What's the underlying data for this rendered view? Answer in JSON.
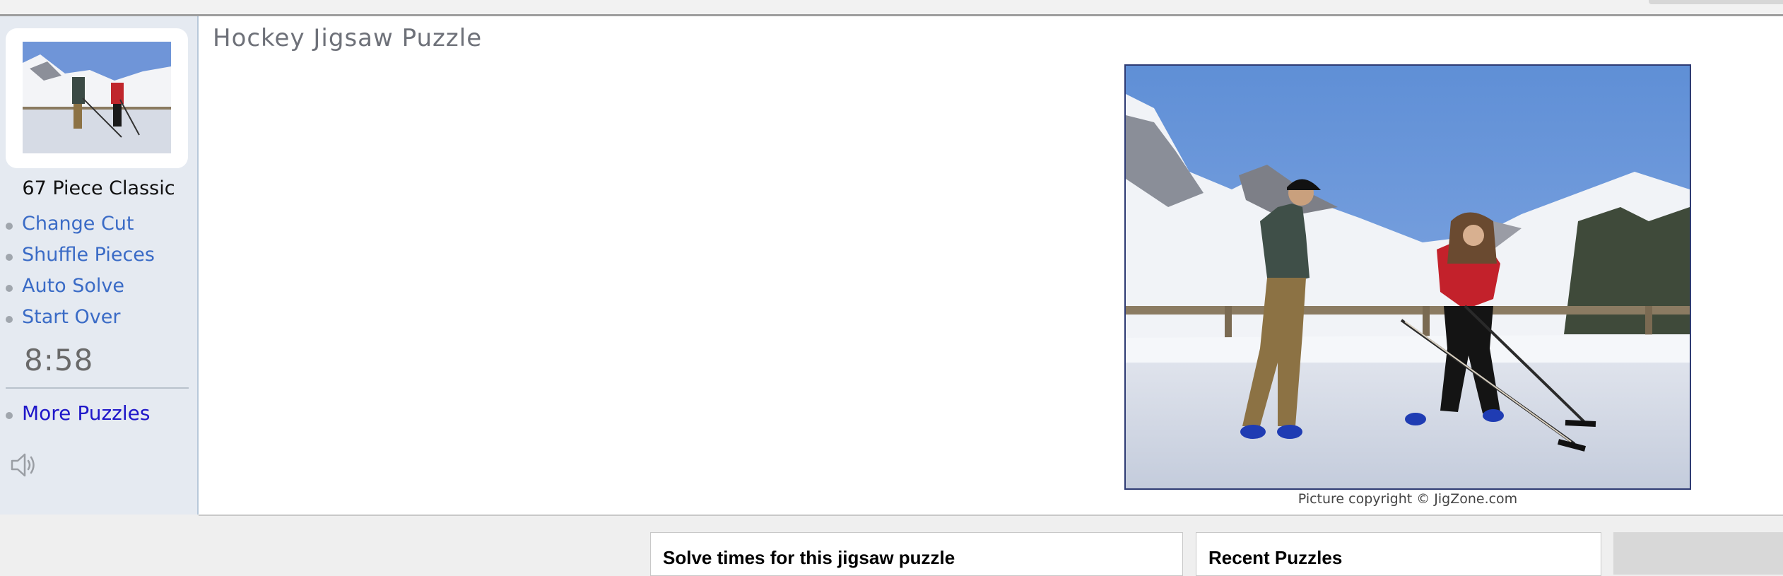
{
  "page": {
    "title": "Hockey Jigsaw Puzzle"
  },
  "sidebar": {
    "piece_label": "67 Piece Classic",
    "menu": [
      {
        "label": "Change Cut"
      },
      {
        "label": "Shuffle Pieces"
      },
      {
        "label": "Auto Solve"
      },
      {
        "label": "Start Over"
      }
    ],
    "timer": "8:58",
    "more_puzzles": "More Puzzles",
    "sound_icon": "speaker-icon"
  },
  "puzzle": {
    "caption": "Picture copyright © JigZone.com"
  },
  "bottom": {
    "solve_times_title": "Solve times for this jigsaw puzzle",
    "recent_title": "Recent Puzzles"
  },
  "colors": {
    "link": "#3a6bc6",
    "more_link": "#1f17c9",
    "sidebar_bg": "#e5eaf1",
    "title_text": "#6e7179"
  }
}
